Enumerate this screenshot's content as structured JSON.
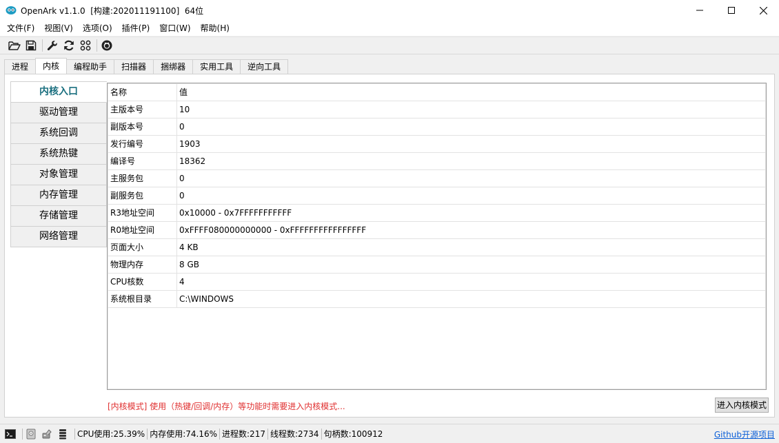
{
  "window": {
    "title": "OpenArk v1.1.0  [构建:202011191100]  64位",
    "controls": [
      "minimize-icon",
      "maximize-icon",
      "close-icon"
    ]
  },
  "menu": [
    "文件(F)",
    "视图(V)",
    "选项(O)",
    "插件(P)",
    "窗口(W)",
    "帮助(H)"
  ],
  "toolbar": {
    "icons": [
      "open-folder-icon",
      "save-icon",
      "wrench-icon",
      "refresh-icon",
      "grid-icon",
      "github-icon"
    ]
  },
  "tabs": {
    "items": [
      "进程",
      "内核",
      "编程助手",
      "扫描器",
      "捆绑器",
      "实用工具",
      "逆向工具"
    ],
    "active": "内核"
  },
  "sidenav": {
    "items": [
      "内核入口",
      "驱动管理",
      "系统回调",
      "系统热键",
      "对象管理",
      "内存管理",
      "存储管理",
      "网络管理"
    ],
    "active": "内核入口"
  },
  "table": {
    "headers": [
      "名称",
      "值"
    ],
    "rows": [
      [
        "主版本号",
        "10"
      ],
      [
        "副版本号",
        "0"
      ],
      [
        "发行编号",
        "1903"
      ],
      [
        "编译号",
        "18362"
      ],
      [
        "主服务包",
        "0"
      ],
      [
        "副服务包",
        "0"
      ],
      [
        "R3地址空间",
        "0x10000 - 0x7FFFFFFFFFFF"
      ],
      [
        "R0地址空间",
        "0xFFFF080000000000 - 0xFFFFFFFFFFFFFFFF"
      ],
      [
        "页面大小",
        "4 KB"
      ],
      [
        "物理内存",
        "8 GB"
      ],
      [
        "CPU核数",
        "4"
      ],
      [
        "系统根目录",
        "C:\\WINDOWS"
      ]
    ]
  },
  "notice": "[内核模式] 使用（热键/回调/内存）等功能时需要进入内核模式...",
  "kernel_button": "进入内核模式",
  "status": {
    "icons": [
      "console-icon",
      "disk-icon",
      "tools-icon",
      "stack-icon"
    ],
    "cpu": "CPU使用:25.39%",
    "mem": "内存使用:74.16%",
    "procs": "进程数:217",
    "threads": "线程数:2734",
    "handles": "句柄数:100912",
    "link": "Github开源项目"
  },
  "colors": {
    "active_nav_text": "#1a6f7f",
    "notice_text": "#e03030",
    "link": "#0b5fd8"
  }
}
